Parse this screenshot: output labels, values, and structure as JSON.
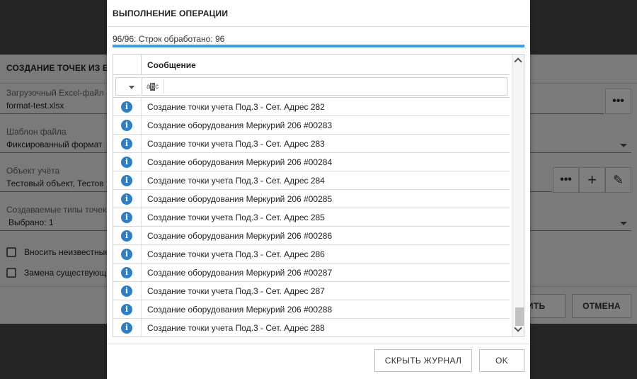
{
  "background_dialog": {
    "title": "СОЗДАНИЕ ТОЧЕК ИЗ EXC",
    "file_label": "Загрузочный Excel-файл",
    "file_value": "format-test.xlsx",
    "template_label": "Шаблон файла",
    "template_value": "Фиксированный формат",
    "object_label": "Объект учёта",
    "object_value": "Тестовый объект, Тестов",
    "types_label": "Создаваемые типы точек",
    "types_value": "Выбрано: 1",
    "checkbox1_label": "Вносить неизвестные",
    "checkbox2_label": "Замена существующих",
    "start_button": "СТИТЬ",
    "cancel_button": "ОТМЕНА",
    "dots": "•••",
    "plus": "+",
    "pencil": "✎"
  },
  "modal": {
    "title": "ВЫПОЛНЕНИЕ ОПЕРАЦИИ",
    "progress_text": "96/96: Строк обработано: 96",
    "progress_fraction": 1.0,
    "grid": {
      "column_header": "Сообщение",
      "filter_icon": "abc-filter-icon",
      "rows": [
        {
          "icon": "info-icon",
          "message": "Создание точки учета Под.3 - Сет. Адрес 282"
        },
        {
          "icon": "info-icon",
          "message": "Создание оборудования Меркурий 206 #00283"
        },
        {
          "icon": "info-icon",
          "message": "Создание точки учета Под.3 - Сет. Адрес 283"
        },
        {
          "icon": "info-icon",
          "message": "Создание оборудования Меркурий 206 #00284"
        },
        {
          "icon": "info-icon",
          "message": "Создание точки учета Под.3 - Сет. Адрес 284"
        },
        {
          "icon": "info-icon",
          "message": "Создание оборудования Меркурий 206 #00285"
        },
        {
          "icon": "info-icon",
          "message": "Создание точки учета Под.3 - Сет. Адрес 285"
        },
        {
          "icon": "info-icon",
          "message": "Создание оборудования Меркурий 206 #00286"
        },
        {
          "icon": "info-icon",
          "message": "Создание точки учета Под.3 - Сет. Адрес 286"
        },
        {
          "icon": "info-icon",
          "message": "Создание оборудования Меркурий 206 #00287"
        },
        {
          "icon": "info-icon",
          "message": "Создание точки учета Под.3 - Сет. Адрес 287"
        },
        {
          "icon": "info-icon",
          "message": "Создание оборудования Меркурий 206 #00288"
        },
        {
          "icon": "info-icon",
          "message": "Создание точки учета Под.3 - Сет. Адрес 288"
        }
      ]
    },
    "hide_log_button": "СКРЫТЬ ЖУРНАЛ",
    "ok_button": "OK"
  },
  "colors": {
    "progress": "#3e9ee8",
    "info_icon": "#2f7dc3"
  }
}
